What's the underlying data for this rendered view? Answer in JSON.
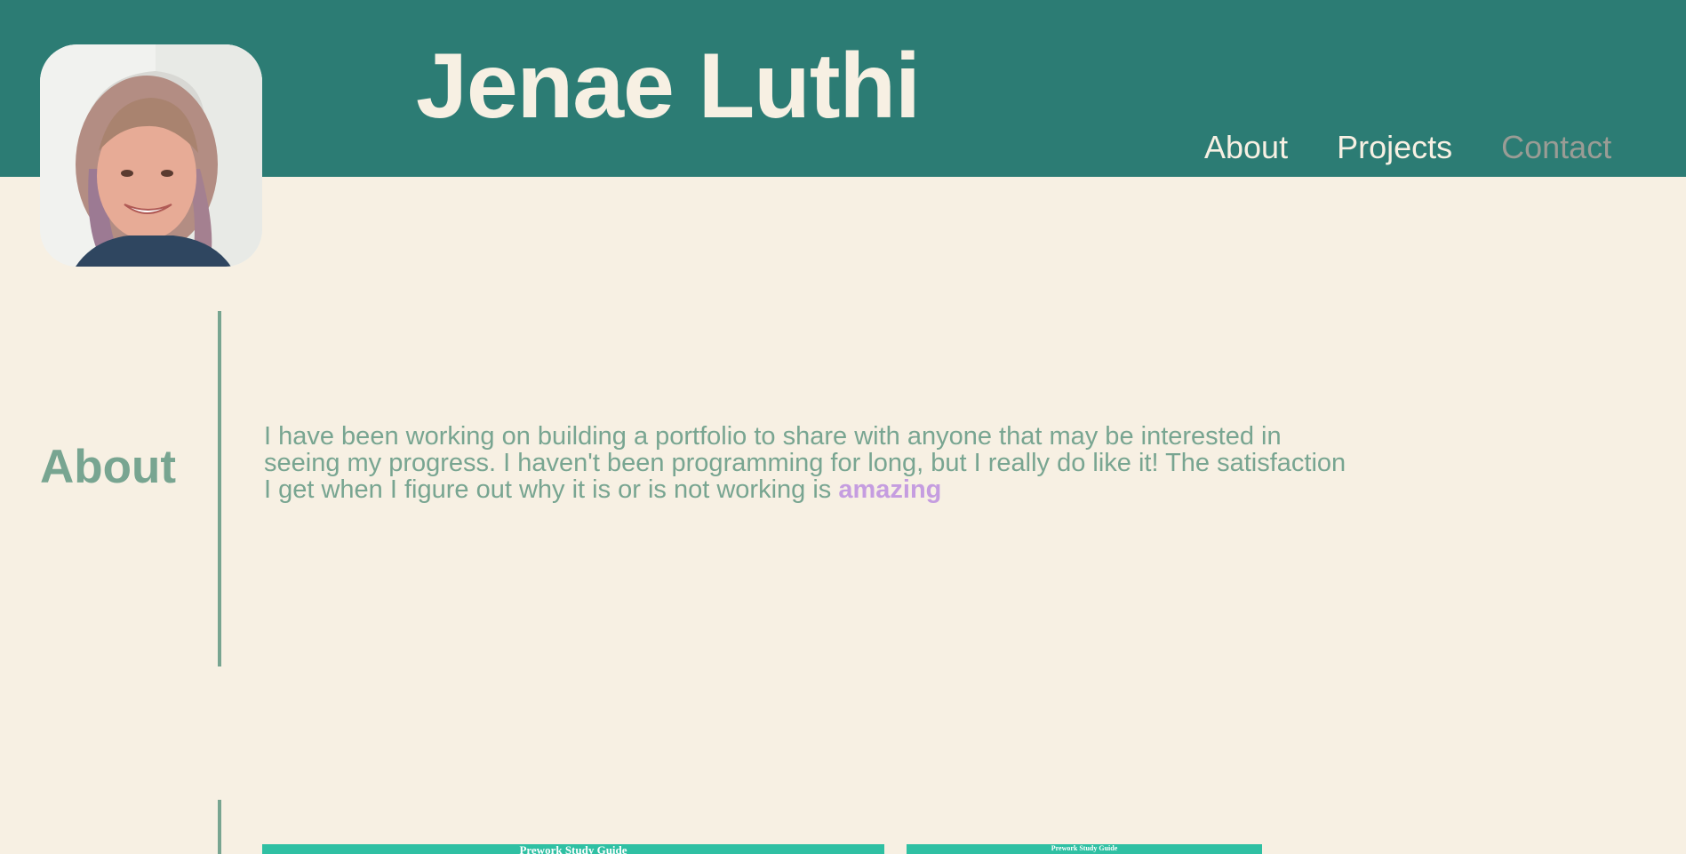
{
  "header": {
    "title": "Jenae Luthi",
    "avatar_icon": "profile-photo",
    "background_color": "#2c7c74"
  },
  "nav": {
    "about": "About",
    "projects": "Projects",
    "contact": "Contact"
  },
  "about": {
    "heading": "About",
    "text": "I have been working on building a portfolio to share with anyone that may be interested in seeing my progress. I haven't been programming for long, but I really do like it! The satisfaction I get when I figure out why it is or is not working is",
    "highlight": "amazing"
  },
  "projects": {
    "cards": [
      {
        "title": "Prework Study Guide"
      },
      {
        "title": "Prework Study Guide"
      }
    ]
  },
  "colors": {
    "page_background": "#f7f0e3",
    "accent": "#78a591",
    "highlight": "#c59de0",
    "card": "#2fc0a3"
  }
}
